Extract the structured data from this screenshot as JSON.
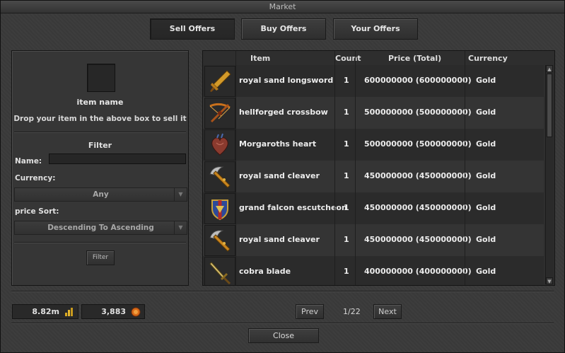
{
  "window": {
    "title": "Market"
  },
  "tabs": [
    {
      "label": "Sell Offers",
      "active": true
    },
    {
      "label": "Buy Offers",
      "active": false
    },
    {
      "label": "Your Offers",
      "active": false
    }
  ],
  "sell_panel": {
    "item_name": "item name",
    "drop_hint": "Drop your item in the above box to sell it"
  },
  "filter": {
    "title": "Filter",
    "name_label": "Name:",
    "name_value": "",
    "currency_label": "Currency:",
    "currency_selected": "Any",
    "sort_label": "price Sort:",
    "sort_selected": "Descending To Ascending",
    "button": "Filter"
  },
  "table": {
    "headers": {
      "item": "Item",
      "count": "Count",
      "price": "Price (Total)",
      "currency": "Currency"
    },
    "rows": [
      {
        "icon": "sword-icon",
        "item": "royal sand longsword",
        "count": "1",
        "price": "600000000 (600000000)",
        "currency": "Gold"
      },
      {
        "icon": "crossbow-icon",
        "item": "hellforged crossbow",
        "count": "1",
        "price": "500000000 (500000000)",
        "currency": "Gold"
      },
      {
        "icon": "heart-icon",
        "item": "Morgaroths heart",
        "count": "1",
        "price": "500000000 (500000000)",
        "currency": "Gold"
      },
      {
        "icon": "axe-icon",
        "item": "royal sand cleaver",
        "count": "1",
        "price": "450000000 (450000000)",
        "currency": "Gold"
      },
      {
        "icon": "shield-icon",
        "item": "grand falcon escutcheon",
        "count": "1",
        "price": "450000000 (450000000)",
        "currency": "Gold"
      },
      {
        "icon": "axe-icon",
        "item": "royal sand cleaver",
        "count": "1",
        "price": "450000000 (450000000)",
        "currency": "Gold"
      },
      {
        "icon": "blade-icon",
        "item": "cobra blade",
        "count": "1",
        "price": "400000000 (400000000)",
        "currency": "Gold"
      }
    ]
  },
  "balances": {
    "gold": {
      "value": "8.82m",
      "icon": "gold-coins-icon"
    },
    "points": {
      "value": "3,883",
      "icon": "coin-icon"
    }
  },
  "pagination": {
    "prev": "Prev",
    "info": "1/22",
    "next": "Next"
  },
  "footer": {
    "close": "Close"
  },
  "colors": {
    "background": "#3a3a3a",
    "panel": "#363636",
    "row_dark": "#2b2b2b",
    "row_light": "#343434",
    "gold": "#c89a1e"
  }
}
